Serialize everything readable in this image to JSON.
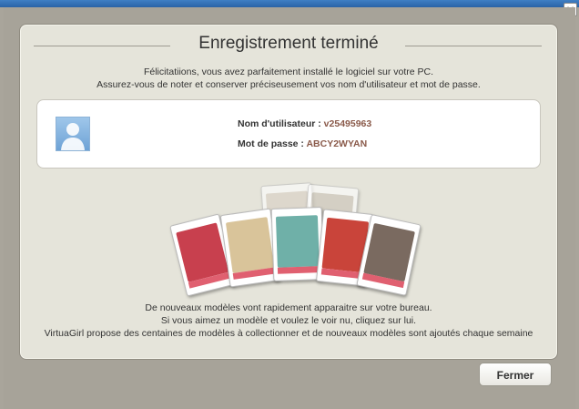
{
  "dialog": {
    "title": "Enregistrement terminé",
    "intro_line1": "Félicitatiions, vous avez parfaitement installé le logiciel sur votre PC.",
    "intro_line2": "Assurez-vous de noter et conserver préciseusement vos nom d'utilisateur et mot de passe.",
    "username_label": "Nom d'utilisateur : ",
    "username_value": "v25495963",
    "password_label": "Mot de passe : ",
    "password_value": "ABCY2WYAN",
    "outro_line1": "De nouveaux modèles vont rapidement apparaitre sur votre bureau.",
    "outro_line2": "Si vous aimez un modèle et voulez le voir nu, cliquez sur lui.",
    "outro_line3": "VirtuaGirl propose des centaines de modèles à collectionner et de nouveaux modèles sont ajoutés chaque semaine",
    "close_button": "Fermer",
    "close_icon_glyph": "×"
  },
  "cards": [
    {
      "icon": "model-card-icon",
      "color": "#c8404e"
    },
    {
      "icon": "model-card-icon",
      "color": "#d9c49a"
    },
    {
      "icon": "model-card-icon",
      "color": "#6fb0a8"
    },
    {
      "icon": "model-card-icon",
      "color": "#c9443a"
    },
    {
      "icon": "model-card-icon",
      "color": "#7a6a60"
    }
  ],
  "colors": {
    "title_bar": "#2a63a6",
    "panel": "#e5e4da",
    "value_text": "#8a5a4a"
  }
}
